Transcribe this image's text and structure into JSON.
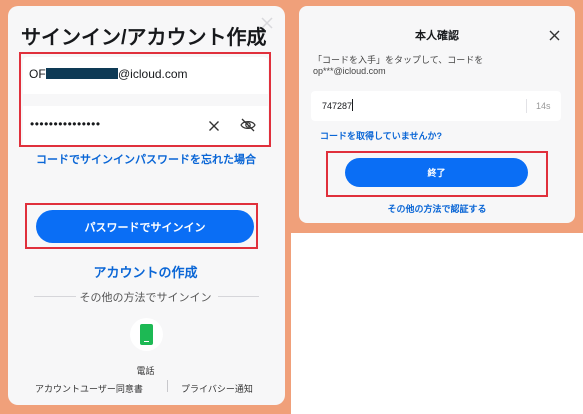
{
  "login": {
    "title": "サインイン/アカウント作成",
    "email_prefix": "OF",
    "email_suffix": "@icloud.com",
    "password_masked": "•••••••••••••••",
    "forgot_link": "コードでサインインパスワードを忘れた場合",
    "signin_button": "パスワードでサインイン",
    "create_account_link": "アカウントの作成",
    "other_methods_divider": "その他の方法でサインイン",
    "phone_label": "電話",
    "user_agreement": "アカウントユーザー同意書",
    "privacy_notice": "プライバシー通知"
  },
  "verify": {
    "title": "本人確認",
    "instruction_line1": "「コードを入手」をタップして、コードを",
    "instruction_line2": "op***@icloud.com",
    "code_value": "747287",
    "timer": "14s",
    "no_code_link": "コードを取得していませんか?",
    "done_button": "終了",
    "other_method_link": "その他の方法で認証する"
  },
  "colors": {
    "accent": "#0a6ef5",
    "highlight": "#e0303c",
    "frame": "#f0a07a",
    "phone_icon": "#1db954"
  },
  "icons": [
    "close-icon",
    "clear-icon",
    "eye-slash-icon",
    "phone-icon"
  ]
}
